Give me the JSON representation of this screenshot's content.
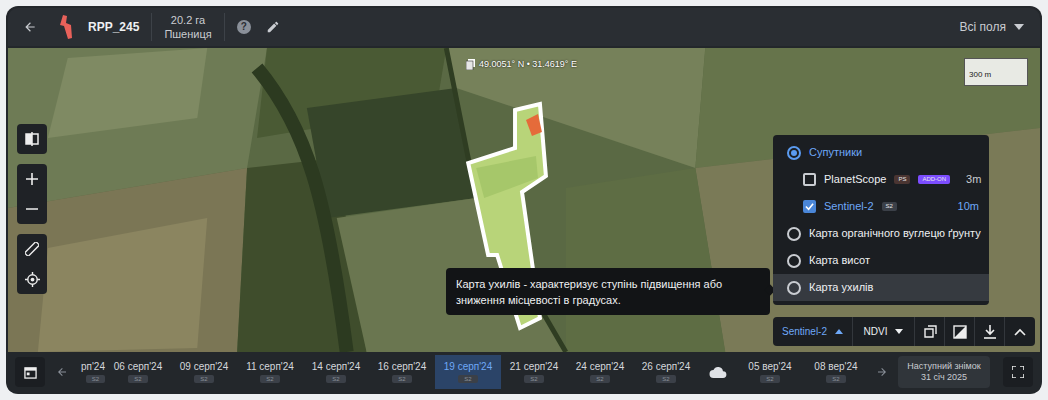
{
  "header": {
    "field_name": "RPP_245",
    "area": "20.2 га",
    "crop": "Пшениця",
    "help_icon": "?",
    "fields_dropdown": "Всі поля"
  },
  "map": {
    "coordinates": "49.0051° N • 31.4619° E",
    "scale": "300 m"
  },
  "layers_panel": {
    "items": [
      {
        "kind": "radio",
        "label": "Супутники",
        "selected": true,
        "hovered": false
      },
      {
        "kind": "checkbox",
        "label": "PlanetScope",
        "checked": false,
        "hovered": false,
        "tags": [
          {
            "label": "PS",
            "color": "#4a3532"
          },
          {
            "label": "ADD-ON",
            "color": "#7c4dff"
          }
        ],
        "resolution": "3m"
      },
      {
        "kind": "checkbox",
        "label": "Sentinel-2",
        "checked": true,
        "hovered": false,
        "tags": [
          {
            "label": "S2",
            "color": "#3b4048"
          }
        ],
        "resolution": "10m"
      },
      {
        "kind": "radio",
        "label": "Карта органічного вуглецю ґрунту",
        "selected": false,
        "hovered": false
      },
      {
        "kind": "radio",
        "label": "Карта висот",
        "selected": false,
        "hovered": false
      },
      {
        "kind": "radio",
        "label": "Карта ухилів",
        "selected": false,
        "hovered": true
      }
    ]
  },
  "tooltip": {
    "text": "Карта ухилів - характеризує ступінь підвищення або зниження місцевості в градусах."
  },
  "controls": {
    "source": "Sentinel-2",
    "index": "NDVI"
  },
  "timeline": {
    "dates": [
      {
        "kind": "date",
        "label": "рп'24",
        "badge": "S2",
        "selected": false
      },
      {
        "kind": "date",
        "label": "06 серп'24",
        "badge": "S2",
        "selected": false
      },
      {
        "kind": "date",
        "label": "09 серп'24",
        "badge": "S2",
        "selected": false
      },
      {
        "kind": "date",
        "label": "11 серп'24",
        "badge": "S2",
        "selected": false
      },
      {
        "kind": "date",
        "label": "14 серп'24",
        "badge": "S2",
        "selected": false
      },
      {
        "kind": "date",
        "label": "16 серп'24",
        "badge": "S2",
        "selected": false
      },
      {
        "kind": "date",
        "label": "19 серп'24",
        "badge": "S2",
        "selected": true
      },
      {
        "kind": "date",
        "label": "21 серп'24",
        "badge": "S2",
        "selected": false
      },
      {
        "kind": "date",
        "label": "24 серп'24",
        "badge": "S2",
        "selected": false
      },
      {
        "kind": "date",
        "label": "26 серп'24",
        "badge": "S2",
        "selected": false
      },
      {
        "kind": "cloud",
        "selected": false
      },
      {
        "kind": "date",
        "label": "05 вер'24",
        "badge": "S2",
        "selected": false
      },
      {
        "kind": "date",
        "label": "08 вер'24",
        "badge": "S2",
        "selected": false
      }
    ],
    "next": {
      "label": "Наступний знімок",
      "date": "31 січ 2025"
    }
  }
}
